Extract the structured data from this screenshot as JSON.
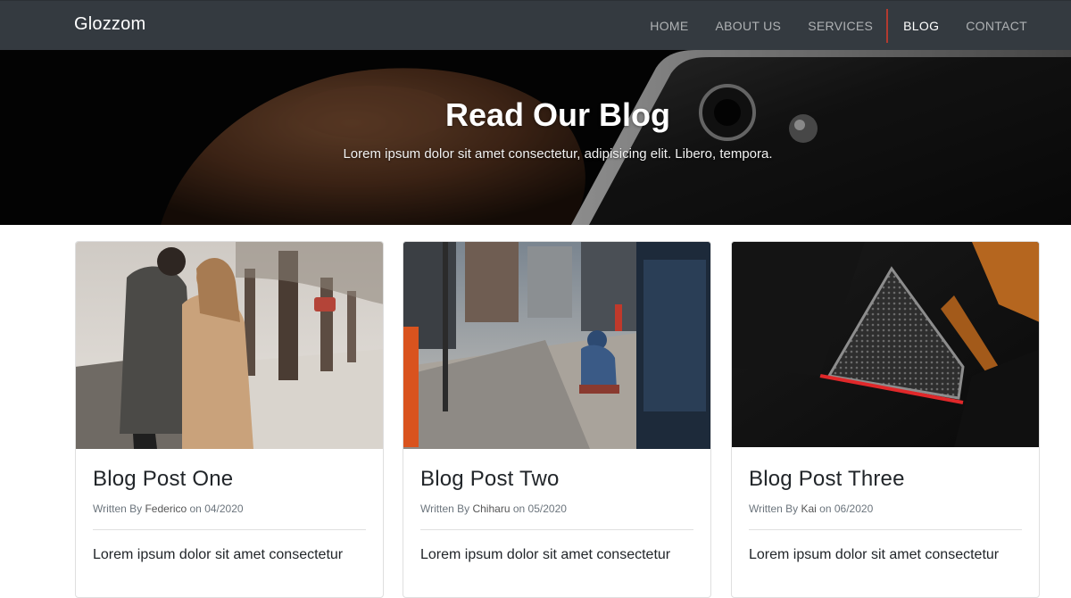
{
  "brand": "Glozzom",
  "nav": {
    "items": [
      {
        "label": "HOME"
      },
      {
        "label": "ABOUT US"
      },
      {
        "label": "SERVICES"
      },
      {
        "label": "BLOG"
      },
      {
        "label": "CONTACT"
      }
    ],
    "active": "BLOG"
  },
  "hero": {
    "title": "Read Our Blog",
    "subtitle": "Lorem ipsum dolor sit amet consectetur, adipisicing elit. Libero, tempora."
  },
  "posts": [
    {
      "title": "Blog Post One",
      "meta_prefix": "Written By",
      "author": "Federico",
      "meta_on": "on",
      "date": "04/2020",
      "excerpt": "Lorem ipsum dolor sit amet consectetur"
    },
    {
      "title": "Blog Post Two",
      "meta_prefix": "Written By",
      "author": "Chiharu",
      "meta_on": "on",
      "date": "05/2020",
      "excerpt": "Lorem ipsum dolor sit amet consectetur"
    },
    {
      "title": "Blog Post Three",
      "meta_prefix": "Written By",
      "author": "Kai",
      "meta_on": "on",
      "date": "06/2020",
      "excerpt": "Lorem ipsum dolor sit amet consectetur"
    }
  ],
  "colors": {
    "navbar_bg": "#343a40",
    "active_indicator": "#b33a2f",
    "card_border": "#dfdfdf"
  }
}
